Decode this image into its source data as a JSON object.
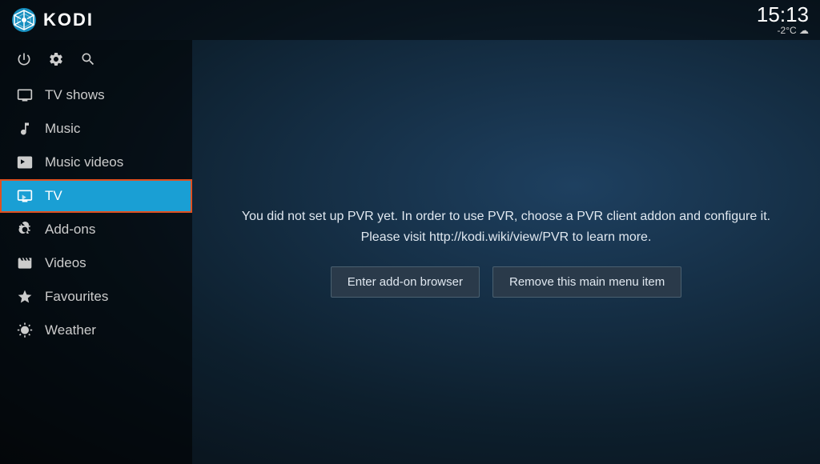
{
  "app": {
    "title": "KODI"
  },
  "clock": {
    "time": "15:13",
    "weather": "-2°C ☁"
  },
  "sidebar": {
    "icon_buttons": [
      {
        "id": "power",
        "label": "⏻"
      },
      {
        "id": "settings",
        "label": "⚙"
      },
      {
        "id": "search",
        "label": "🔍"
      }
    ],
    "items": [
      {
        "id": "tv-shows",
        "label": "TV shows",
        "icon": "tv"
      },
      {
        "id": "music",
        "label": "Music",
        "icon": "music"
      },
      {
        "id": "music-videos",
        "label": "Music videos",
        "icon": "music-video"
      },
      {
        "id": "tv",
        "label": "TV",
        "icon": "tv-live",
        "active": true
      },
      {
        "id": "add-ons",
        "label": "Add-ons",
        "icon": "addon"
      },
      {
        "id": "videos",
        "label": "Videos",
        "icon": "video"
      },
      {
        "id": "favourites",
        "label": "Favourites",
        "icon": "star"
      },
      {
        "id": "weather",
        "label": "Weather",
        "icon": "weather"
      }
    ]
  },
  "pvr": {
    "message_line1": "You did not set up PVR yet. In order to use PVR, choose a PVR client addon and configure it.",
    "message_line2": "Please visit http://kodi.wiki/view/PVR to learn more.",
    "button_addon_browser": "Enter add-on browser",
    "button_remove": "Remove this main menu item"
  }
}
